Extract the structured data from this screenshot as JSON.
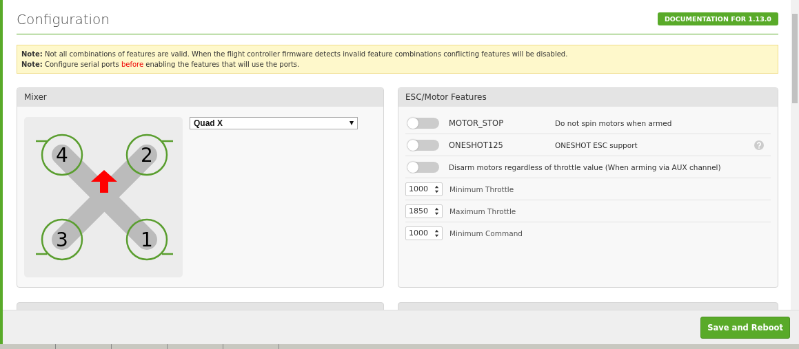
{
  "header": {
    "title": "Configuration",
    "doc_button": "DOCUMENTATION FOR 1.13.0"
  },
  "notes": [
    {
      "text": "**Note:** Not all combinations of features are valid. When the flight controller firmware detects invalid feature combinations conflicting features will be disabled."
    },
    {
      "text": "**Note:** Configure serial ports",
      "highlight": "before",
      "text_after": "enabling the features that will use the ports."
    }
  ],
  "mixer": {
    "title": "Mixer",
    "motors": [
      "4",
      "2",
      "3",
      "1"
    ],
    "select": "Quad X"
  },
  "esc": {
    "title": "ESC/Motor Features",
    "rows": [
      {
        "kind": "switch",
        "checked": false,
        "name": "MOTOR_STOP",
        "description": "Do not spin motors when armed",
        "help": false
      },
      {
        "kind": "switch",
        "checked": false,
        "name": "ONESHOT125",
        "description": "ONESHOT ESC support",
        "help": true
      },
      {
        "kind": "switch",
        "checked": false,
        "description": "Disarm motors regardless of throttle value (When arming via AUX channel)",
        "help": false
      },
      {
        "kind": "number",
        "value": "1000",
        "description": "Minimum Throttle"
      },
      {
        "kind": "number",
        "value": "1850",
        "description": "Maximum Throttle"
      },
      {
        "kind": "number",
        "value": "1000",
        "description": "Minimum Command"
      }
    ]
  },
  "footer": {
    "button": "Save and Reboot"
  }
}
